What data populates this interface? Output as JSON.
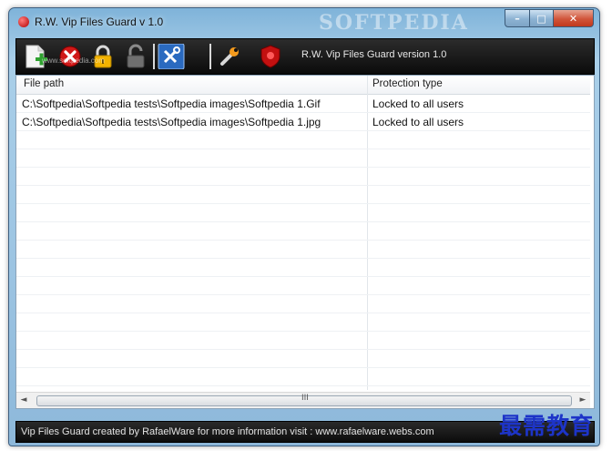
{
  "window": {
    "title": "R.W. Vip Files Guard v 1.0",
    "watermark": "SOFTPEDIA",
    "buttons": {
      "minimize": "–",
      "maximize": "□",
      "close": "✕"
    }
  },
  "toolbar": {
    "icons": [
      "add-file-icon",
      "remove-icon",
      "lock-icon",
      "unlock-icon",
      "tools-icon",
      "wrench-icon",
      "shield-icon"
    ],
    "label": "R.W. Vip Files Guard version 1.0",
    "watermark_small": "www.softpedia.com"
  },
  "grid": {
    "columns": [
      "File path",
      "Protection type"
    ],
    "rows": [
      {
        "path": "C:\\Softpedia\\Softpedia tests\\Softpedia images\\Softpedia 1.Gif",
        "type": "Locked to all users"
      },
      {
        "path": "C:\\Softpedia\\Softpedia tests\\Softpedia images\\Softpedia 1.jpg",
        "type": "Locked to all users"
      }
    ],
    "scroll_grip": "III"
  },
  "status": {
    "text": "Vip Files Guard created by RafaelWare for more information visit : www.rafaelware.webs.com"
  },
  "corner_watermark": "最需教育",
  "colors": {
    "toolbar_bg": "#111111",
    "window_frame": "#9cc4e2",
    "close_red": "#c2381c"
  }
}
